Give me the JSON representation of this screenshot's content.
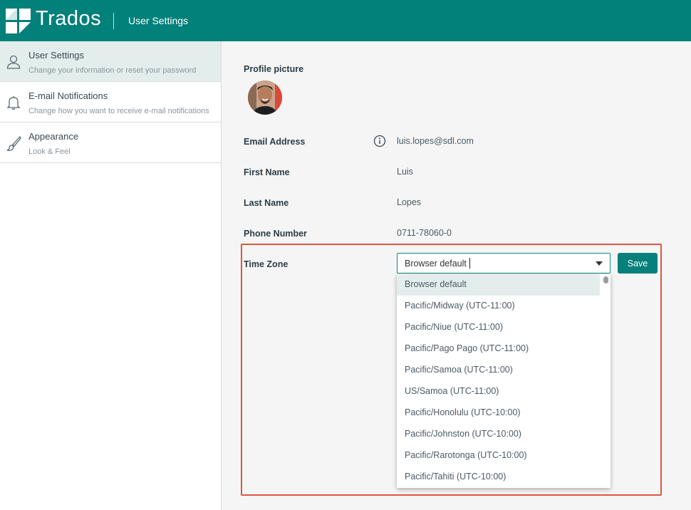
{
  "header": {
    "logo_text": "Trados",
    "section": "User Settings"
  },
  "sidebar": {
    "items": [
      {
        "title": "User Settings",
        "subtitle": "Change your information or reset your password",
        "icon": "user-icon",
        "active": true
      },
      {
        "title": "E-mail Notifications",
        "subtitle": "Change how you want to receive e-mail notifications",
        "icon": "bell-icon",
        "active": false
      },
      {
        "title": "Appearance",
        "subtitle": "Look & Feel",
        "icon": "brush-icon",
        "active": false
      }
    ]
  },
  "profile": {
    "picture_label": "Profile picture",
    "email_label": "Email Address",
    "email_value": "luis.lopes@sdl.com",
    "first_name_label": "First Name",
    "first_name_value": "Luis",
    "last_name_label": "Last Name",
    "last_name_value": "Lopes",
    "phone_label": "Phone Number",
    "phone_value": "0711-78060-0",
    "timezone_label": "Time Zone",
    "timezone_value": "Browser default",
    "save_label": "Save"
  },
  "timezone_options": [
    "Browser default",
    "Pacific/Midway (UTC-11:00)",
    "Pacific/Niue (UTC-11:00)",
    "Pacific/Pago Pago (UTC-11:00)",
    "Pacific/Samoa (UTC-11:00)",
    "US/Samoa (UTC-11:00)",
    "Pacific/Honolulu (UTC-10:00)",
    "Pacific/Johnston (UTC-10:00)",
    "Pacific/Rarotonga (UTC-10:00)",
    "Pacific/Tahiti (UTC-10:00)"
  ],
  "colors": {
    "brand": "#02807a",
    "highlight": "#e2553e",
    "active_bg": "#e3eeec"
  }
}
